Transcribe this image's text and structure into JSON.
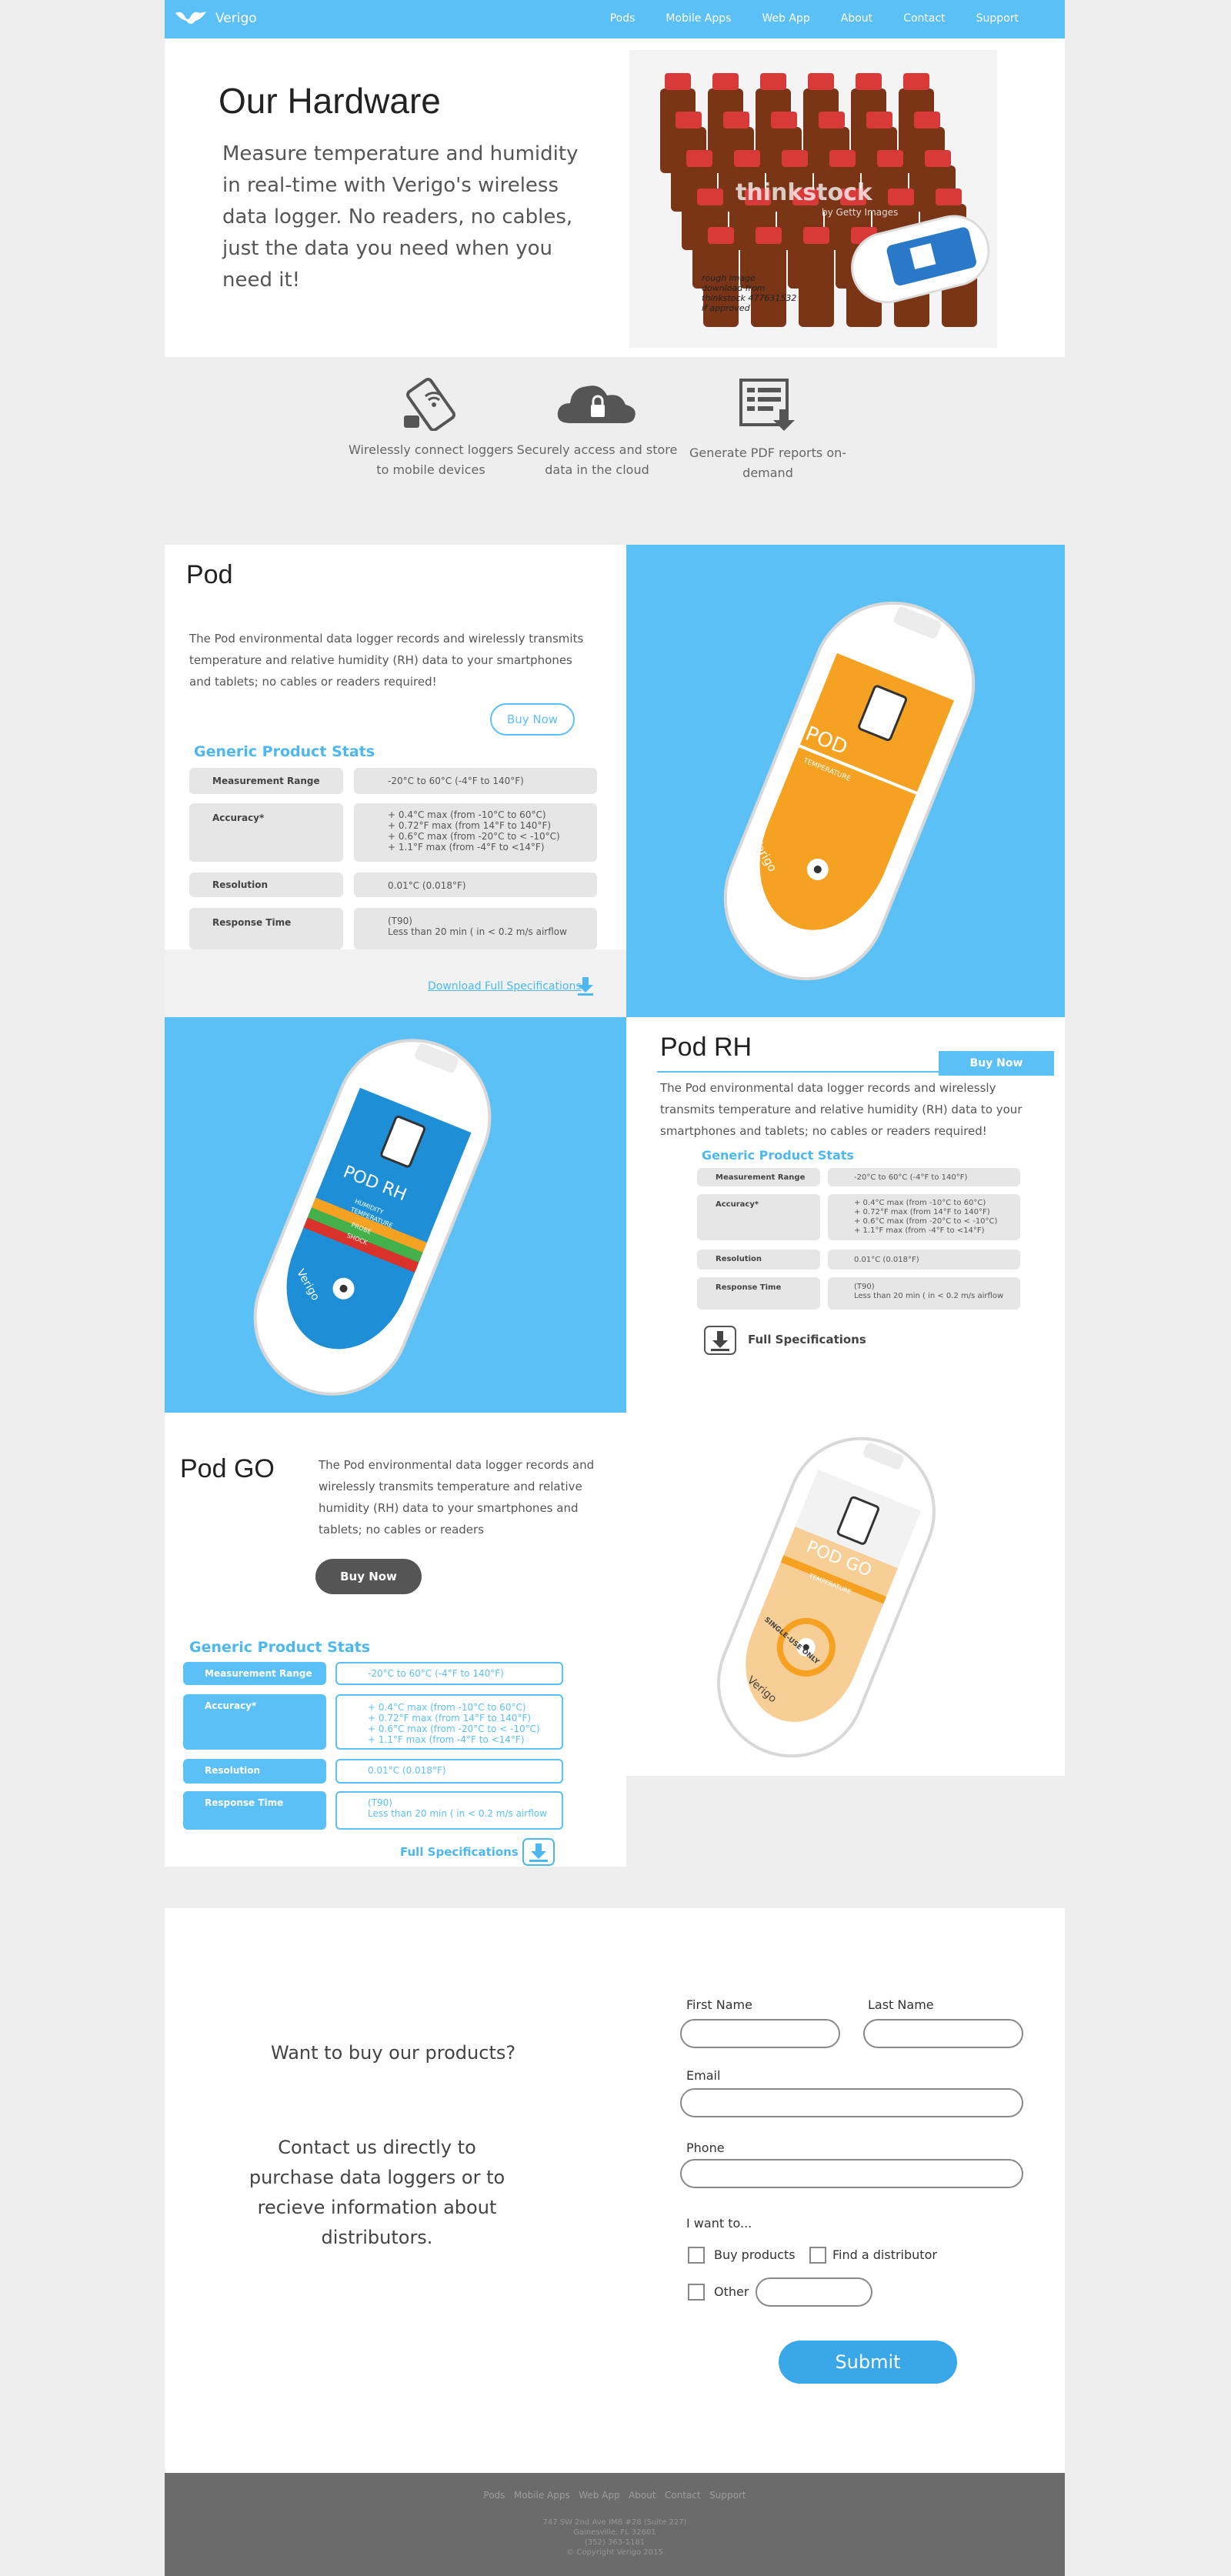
{
  "nav": {
    "brand": "Verigo",
    "links": [
      "Pods",
      "Mobile Apps",
      "Web App",
      "About",
      "Contact",
      "Support"
    ]
  },
  "hero": {
    "title": "Our Hardware",
    "body": "Measure temperature and humidity in real-time with Verigo's wireless data logger. No readers, no cables, just the data you need when you need it!",
    "watermark": "thinkstock",
    "watermark_sub": "by Getty Images",
    "note": [
      "rough image",
      "download from",
      "thinkstock 477631532",
      "if approved"
    ]
  },
  "features": [
    {
      "icon": "mobile-wireless-icon",
      "text": "Wirelessly connect loggers to mobile devices"
    },
    {
      "icon": "cloud-lock-icon",
      "text": "Securely access and store data in the cloud"
    },
    {
      "icon": "pdf-report-icon",
      "text": "Generate PDF reports on-demand"
    }
  ],
  "pod": {
    "title": "Pod",
    "description": "The Pod environmental data logger records and wirelessly transmits temperature and relative humidity (RH) data to your smartphones and tablets; no cables or readers required!",
    "buy": "Buy Now",
    "stats_title": "Generic Product Stats",
    "stats": [
      {
        "label": "Measurement Range",
        "value": [
          "-20°C to 60°C (-4°F to 140°F)"
        ]
      },
      {
        "label": "Accuracy*",
        "value": [
          "+ 0.4°C max  (from -10°C to 60°C)",
          "+ 0.72°F max (from 14°F to 140°F)",
          "+ 0.6°C max (from -20°C to < -10°C)",
          "+ 1.1°F max (from -4°F to <14°F)"
        ]
      },
      {
        "label": "Resolution",
        "value": [
          "0.01°C (0.018°F)"
        ]
      },
      {
        "label": "Response Time",
        "value": [
          "(T90)",
          "Less than 20 min ( in < 0.2 m/s airflow"
        ]
      }
    ],
    "download": "Download Full Specifications",
    "device_label": "POD",
    "device_sub": "TEMPERATURE",
    "device_brand": "Verigo"
  },
  "podrh": {
    "title": "Pod RH",
    "buy": "Buy Now",
    "description": "The Pod environmental data logger records and wirelessly transmits temperature and relative humidity (RH) data to your smartphones and tablets; no cables or readers required!",
    "stats_title": "Generic Product Stats",
    "stats": [
      {
        "label": "Measurement Range",
        "value": [
          "-20°C to 60°C (-4°F to 140°F)"
        ]
      },
      {
        "label": "Accuracy*",
        "value": [
          "+ 0.4°C max  (from -10°C to 60°C)",
          "+ 0.72°F max (from 14°F to 140°F)",
          "+ 0.6°C max (from -20°C to < -10°C)",
          "+ 1.1°F max (from -4°F to <14°F)"
        ]
      },
      {
        "label": "Resolution",
        "value": [
          "0.01°C (0.018°F)"
        ]
      },
      {
        "label": "Response Time",
        "value": [
          "(T90)",
          "Less than 20 min ( in < 0.2 m/s airflow"
        ]
      }
    ],
    "download": "Full Specifications",
    "device_label": "POD RH",
    "device_bands": [
      "HUMIDITY",
      "TEMPERATURE",
      "PROBE",
      "SHOCK"
    ],
    "device_brand": "Verigo"
  },
  "podgo": {
    "title": "Pod GO",
    "description": "The Pod environmental data logger records and wirelessly transmits temperature and relative humidity (RH) data to your smartphones and tablets; no cables or readers",
    "buy": "Buy Now",
    "stats_title": "Generic Product Stats",
    "stats": [
      {
        "label": "Measurement Range",
        "value": [
          "-20°C to 60°C (-4°F to 140°F)"
        ]
      },
      {
        "label": "Accuracy*",
        "value": [
          "+ 0.4°C max  (from -10°C to 60°C)",
          "+ 0.72°F max (from 14°F to 140°F)",
          "+ 0.6°C max (from -20°C to < -10°C)",
          "+ 1.1°F max (from -4°F to <14°F)"
        ]
      },
      {
        "label": "Resolution",
        "value": [
          "0.01°C (0.018°F)"
        ]
      },
      {
        "label": "Response Time",
        "value": [
          "(T90)",
          "Less than 20 min ( in < 0.2 m/s airflow"
        ]
      }
    ],
    "download": "Full Specifications",
    "device_label": "POD GO",
    "device_sub": "TEMPERATURE",
    "device_ring": "SINGLE-USE ONLY",
    "device_brand": "Verigo"
  },
  "contact": {
    "heading": "Want to buy our products?",
    "body": "Contact us directly to purchase data loggers or to recieve information about distributors.",
    "first_name": "First Name",
    "last_name": "Last Name",
    "email": "Email",
    "phone": "Phone",
    "want": "I want to...",
    "opt_buy": "Buy products",
    "opt_find": "Find a distributor",
    "opt_other": "Other",
    "submit": "Submit"
  },
  "footer": {
    "links": [
      "Pods",
      "Mobile Apps",
      "Web App",
      "About",
      "Contact",
      "Support"
    ],
    "address": [
      "747 SW 2nd Ave IMB #28 (Suite 227)",
      "Gainesville, FL 32601",
      "(352) 363-1181",
      "© Copyright Verigo 2015"
    ]
  },
  "colors": {
    "accent": "#5bc0f5",
    "pod": "#f5a122",
    "podrh": "#1e8fd6",
    "podgo": "#f7cf96",
    "submit": "#3aa8e8",
    "footer": "#6b6b6b"
  }
}
